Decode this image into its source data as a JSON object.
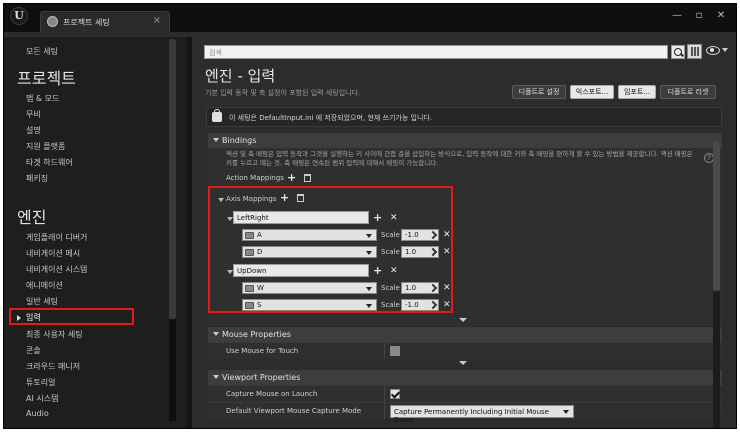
{
  "window": {
    "tab_label": "프로젝트 세팅",
    "tab_close": "×",
    "minimize": "—",
    "maximize": "▫",
    "close": "✕",
    "logo_letter": "U"
  },
  "sidebar": {
    "all_settings": "모든 세팅",
    "project_heading": "프로젝트",
    "project_items": [
      "맵 & 모드",
      "무비",
      "설명",
      "지원 플랫폼",
      "타겟 하드웨어",
      "패키징"
    ],
    "engine_heading": "엔진",
    "engine_items": [
      "게임플레이 디버거",
      "내비게이션 메시",
      "내비게이션 시스템",
      "애니메이션",
      "일반 세팅",
      "입력",
      "최종 사용자 세팅",
      "콘솔",
      "크라우드 매니저",
      "튜토리얼",
      "AI 시스템",
      "Audio"
    ],
    "selected_item": "입력"
  },
  "header": {
    "search_placeholder": "검색",
    "title": "엔진 - 입력",
    "subtitle": "기본 입력 동작 및 축 설정이 포함된 입력 세팅입니다.",
    "buttons": [
      "디폴트로 설정",
      "익스포트...",
      "임포트...",
      "디폴트로 리셋"
    ]
  },
  "notice": {
    "text": "이 세팅은 DefaultInput.ini 에 저장되었으며, 현재 쓰기가능 입니다."
  },
  "bindings": {
    "title": "Bindings",
    "description": "액션 및 축 매핑은 입력 동작과 그것을 실행하는 키 사이에 간접 층을 삽입하는 방식으로, 입력 동작에 대한 키와 축 매핑을 편하게 할 수 있는 방법을 제공합니다. 액션 매핑은 키를 누르고 떼는 것, 축 매핑은 연속된 범위 입력에 대해서 매핑이 가능합니다.",
    "help": "?",
    "action_mappings_label": "Action Mappings",
    "axis_mappings_label": "Axis Mappings",
    "scale_label": "Scale",
    "axes": [
      {
        "name": "LeftRight",
        "keys": [
          {
            "key": "A",
            "scale": "-1.0"
          },
          {
            "key": "D",
            "scale": "1.0"
          }
        ]
      },
      {
        "name": "UpDown",
        "keys": [
          {
            "key": "W",
            "scale": "1.0"
          },
          {
            "key": "S",
            "scale": "-1.0"
          }
        ]
      }
    ]
  },
  "mouse_properties": {
    "title": "Mouse Properties",
    "use_mouse_for_touch_label": "Use Mouse for Touch",
    "use_mouse_for_touch": false
  },
  "viewport_properties": {
    "title": "Viewport Properties",
    "capture_mouse_label": "Capture Mouse on Launch",
    "capture_mouse": true,
    "capture_mode_label": "Default Viewport Mouse Capture Mode",
    "capture_mode_value": "Capture Permanently Including Initial Mouse Down"
  },
  "colors": {
    "highlight": "#e41a1a",
    "panel": "#2c2c2c",
    "sidebar": "#1e1e1e"
  }
}
